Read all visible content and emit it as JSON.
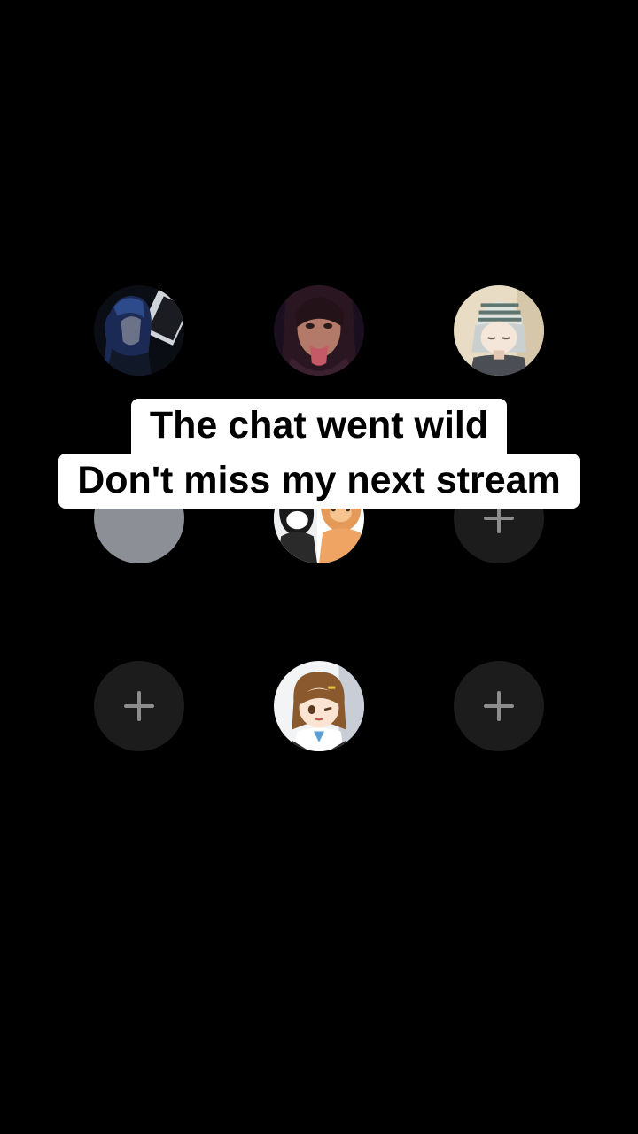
{
  "caption": {
    "line1": "The chat went wild",
    "line2": "Don't miss my next stream"
  },
  "grid": {
    "slots": [
      {
        "kind": "avatar",
        "name": "dark-anime-character"
      },
      {
        "kind": "avatar",
        "name": "woman-portrait"
      },
      {
        "kind": "avatar",
        "name": "anime-girl-beanie"
      },
      {
        "kind": "placeholder",
        "name": "gray-avatar-placeholder"
      },
      {
        "kind": "avatar",
        "name": "cartoon-cat-characters"
      },
      {
        "kind": "add",
        "name": "plus-icon"
      },
      {
        "kind": "add",
        "name": "plus-icon"
      },
      {
        "kind": "avatar",
        "name": "anime-girl-brown-hair"
      },
      {
        "kind": "add",
        "name": "plus-icon"
      }
    ]
  },
  "colors": {
    "background": "#000000",
    "empty_slot": "#1c1c1c",
    "plus": "#8d8d8d",
    "caption_bg": "#ffffff",
    "caption_text": "#000000"
  }
}
